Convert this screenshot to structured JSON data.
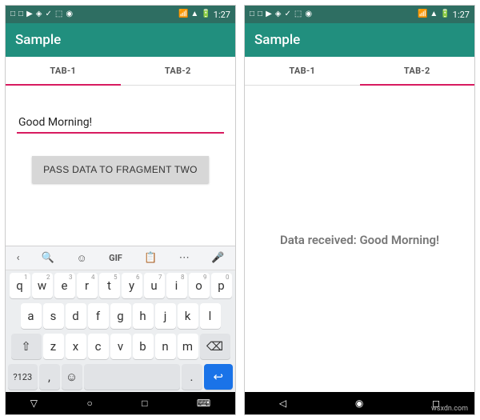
{
  "watermark": "wsxdn.com",
  "statusbar": {
    "time": "1:27",
    "icons_left": [
      "□",
      "□",
      "▶",
      "◈",
      "✓",
      "⬚",
      "◉"
    ],
    "icons_right": [
      "📶",
      "▲",
      "🔋"
    ]
  },
  "appbar": {
    "title": "Sample"
  },
  "tabs": {
    "tab1": "TAB-1",
    "tab2": "TAB-2"
  },
  "screen1": {
    "input_value": "Good Morning!",
    "button_label": "PASS DATA TO FRAGMENT TWO"
  },
  "screen2": {
    "received_text": "Data received: Good Morning!"
  },
  "keyboard": {
    "toolbar": [
      "‹",
      "🔍",
      "☺",
      "GIF",
      "📋",
      "⋯",
      "🎤"
    ],
    "row1": [
      {
        "k": "q",
        "s": "1"
      },
      {
        "k": "w",
        "s": "2"
      },
      {
        "k": "e",
        "s": "3"
      },
      {
        "k": "r",
        "s": "4"
      },
      {
        "k": "t",
        "s": "5"
      },
      {
        "k": "y",
        "s": "6"
      },
      {
        "k": "u",
        "s": "7"
      },
      {
        "k": "i",
        "s": "8"
      },
      {
        "k": "o",
        "s": "9"
      },
      {
        "k": "p",
        "s": "0"
      }
    ],
    "row2": [
      "a",
      "s",
      "d",
      "f",
      "g",
      "h",
      "j",
      "k",
      "l"
    ],
    "row3": {
      "shift": "⇧",
      "keys": [
        "z",
        "x",
        "c",
        "v",
        "b",
        "n",
        "m"
      ],
      "back": "⌫"
    },
    "row4": {
      "sym": "?123",
      "comma": ",",
      "emoji": "☺",
      "space": " ",
      "period": ".",
      "enter": "↩"
    }
  },
  "navbar": {
    "back": "▽",
    "home": "○",
    "recent": "□",
    "kb": "⌨"
  }
}
